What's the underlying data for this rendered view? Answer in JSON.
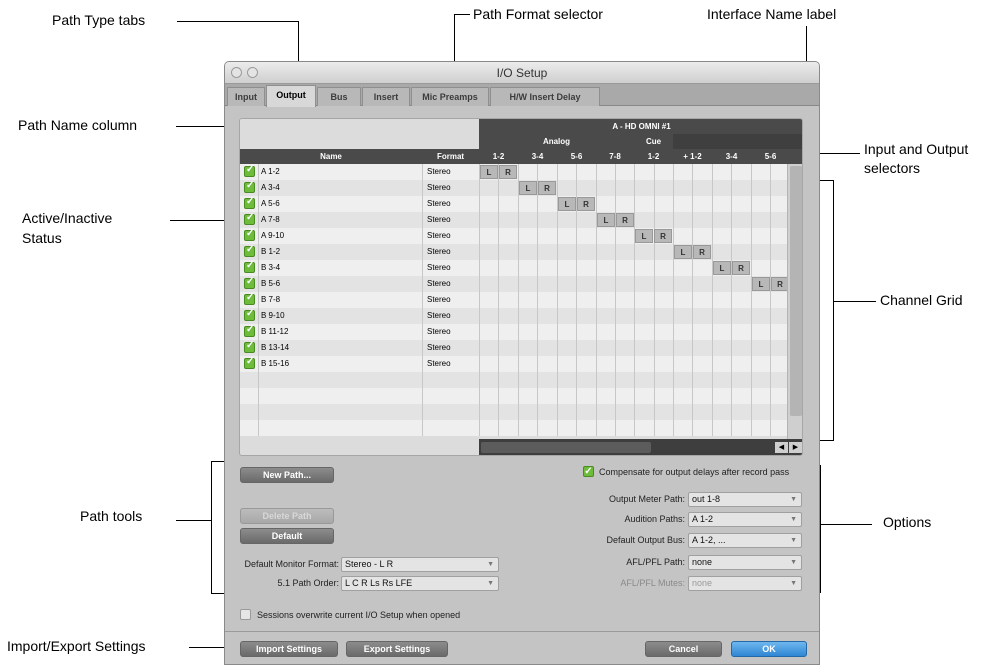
{
  "callouts": {
    "path_type_tabs": "Path Type tabs",
    "path_format_selector": "Path Format selector",
    "interface_name_label": "Interface Name label",
    "path_name_column": "Path Name column",
    "input_output_selectors_1": "Input and Output",
    "input_output_selectors_2": "selectors",
    "active_status_1": "Active/Inactive",
    "active_status_2": "Status",
    "channel_grid": "Channel Grid",
    "path_tools": "Path tools",
    "options": "Options",
    "import_export": "Import/Export Settings"
  },
  "window": {
    "title": "I/O Setup"
  },
  "tabs": [
    {
      "label": "Input"
    },
    {
      "label": "Output",
      "active": true
    },
    {
      "label": "Bus"
    },
    {
      "label": "Insert"
    },
    {
      "label": "Mic Preamps"
    },
    {
      "label": "H/W Insert Delay"
    }
  ],
  "grid": {
    "interface_name": "A - HD OMNI #1",
    "group_analog": "Analog",
    "group_cue": "Cue",
    "col_name": "Name",
    "col_format": "Format",
    "channels": [
      "1-2",
      "3-4",
      "5-6",
      "7-8",
      "1-2",
      "+ 1-2",
      "3-4",
      "5-6"
    ],
    "rows": [
      {
        "name": "A 1-2",
        "format": "Stereo",
        "slot": 0
      },
      {
        "name": "A 3-4",
        "format": "Stereo",
        "slot": 1
      },
      {
        "name": "A 5-6",
        "format": "Stereo",
        "slot": 2
      },
      {
        "name": "A 7-8",
        "format": "Stereo",
        "slot": 3
      },
      {
        "name": "A 9-10",
        "format": "Stereo",
        "slot": 4
      },
      {
        "name": "B 1-2",
        "format": "Stereo",
        "slot": 5
      },
      {
        "name": "B 3-4",
        "format": "Stereo",
        "slot": 6
      },
      {
        "name": "B 5-6",
        "format": "Stereo",
        "slot": 7
      },
      {
        "name": "B 7-8",
        "format": "Stereo"
      },
      {
        "name": "B 9-10",
        "format": "Stereo"
      },
      {
        "name": "B 11-12",
        "format": "Stereo"
      },
      {
        "name": "B 13-14",
        "format": "Stereo"
      },
      {
        "name": "B 15-16",
        "format": "Stereo"
      }
    ],
    "left_label": "L",
    "right_label": "R"
  },
  "path_tools": {
    "new_path": "New Path...",
    "delete_path": "Delete Path",
    "default": "Default",
    "monitor_format_label": "Default Monitor Format:",
    "monitor_format_value": "Stereo - L R",
    "path_order_label": "5.1 Path Order:",
    "path_order_value": "L C R Ls Rs LFE",
    "sessions_overwrite": "Sessions overwrite current I/O Setup when opened"
  },
  "options": {
    "compensate": "Compensate for output delays after record pass",
    "output_meter_label": "Output Meter Path:",
    "output_meter_value": "out 1-8",
    "audition_label": "Audition Paths:",
    "audition_value": "A 1-2",
    "default_bus_label": "Default Output Bus:",
    "default_bus_value": "A 1-2, ...",
    "afl_path_label": "AFL/PFL Path:",
    "afl_path_value": "none",
    "afl_mutes_label": "AFL/PFL Mutes:",
    "afl_mutes_value": "none"
  },
  "footer": {
    "import": "Import Settings",
    "export": "Export Settings",
    "cancel": "Cancel",
    "ok": "OK"
  }
}
